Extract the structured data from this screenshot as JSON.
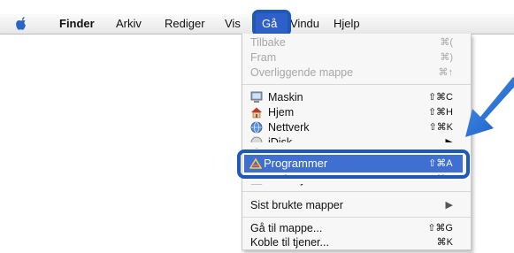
{
  "menubar": {
    "items": [
      "Finder",
      "Arkiv",
      "Rediger",
      "Vis",
      "Gå",
      "Vindu",
      "Hjelp"
    ],
    "active": "Gå"
  },
  "go_menu": {
    "items": [
      {
        "label": "Tilbake",
        "shortcut": "⌘(",
        "disabled": true
      },
      {
        "label": "Fram",
        "shortcut": "⌘)",
        "disabled": true
      },
      {
        "label": "Overliggende mappe",
        "shortcut": "⌘↑",
        "disabled": true
      },
      {
        "label": "Maskin",
        "shortcut": "⇧⌘C",
        "icon": "computer-icon"
      },
      {
        "label": "Hjem",
        "shortcut": "⇧⌘H",
        "icon": "home-icon"
      },
      {
        "label": "Nettverk",
        "shortcut": "⇧⌘K",
        "icon": "network-icon"
      },
      {
        "label": "iDisk",
        "shortcut": "▶",
        "icon": "idisk-icon",
        "partially_hidden": true
      },
      {
        "label": "Programmer",
        "shortcut": "⇧⌘A",
        "icon": "applications-icon",
        "highlighted": true
      },
      {
        "label": "Verktøy",
        "shortcut": "⇧⌘U",
        "icon": "utilities-icon",
        "partially_hidden": true
      },
      {
        "label": "Sist brukte mapper",
        "shortcut": "▶"
      },
      {
        "label": "Gå til mappe...",
        "shortcut": "⇧⌘G"
      },
      {
        "label": "Koble til tjener...",
        "shortcut": "⌘K"
      }
    ]
  },
  "colors": {
    "highlight": "#3f6fd1",
    "callout_border": "#1e59b9",
    "callout_arrow": "#1f6fd6"
  }
}
